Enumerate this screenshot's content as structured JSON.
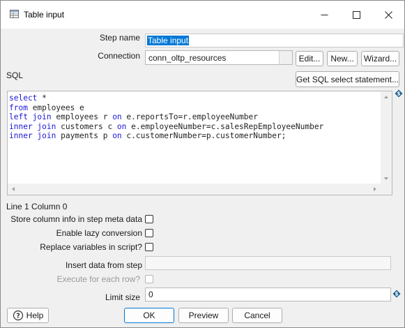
{
  "window": {
    "title": "Table input"
  },
  "form": {
    "step_name_label": "Step name",
    "step_name_value": "Table input",
    "connection_label": "Connection",
    "connection_value": "conn_oltp_resources",
    "edit_button": "Edit...",
    "new_button": "New...",
    "wizard_button": "Wizard...",
    "sql_label": "SQL",
    "get_sql_button": "Get SQL select statement...",
    "sql_lines": [
      [
        {
          "t": "select",
          "kw": true
        },
        {
          "t": " *",
          "kw": false
        }
      ],
      [
        {
          "t": "from",
          "kw": true
        },
        {
          "t": " employees e",
          "kw": false
        }
      ],
      [
        {
          "t": "left join",
          "kw": true
        },
        {
          "t": " employees r ",
          "kw": false
        },
        {
          "t": "on",
          "kw": true
        },
        {
          "t": " e.reportsTo=r.employeeNumber",
          "kw": false
        }
      ],
      [
        {
          "t": "inner join",
          "kw": true
        },
        {
          "t": " customers c ",
          "kw": false
        },
        {
          "t": "on",
          "kw": true
        },
        {
          "t": " e.employeeNumber=c.salesRepEmployeeNumber",
          "kw": false
        }
      ],
      [
        {
          "t": "inner join",
          "kw": true
        },
        {
          "t": " payments p ",
          "kw": false
        },
        {
          "t": "on",
          "kw": true
        },
        {
          "t": " c.customerNumber=p.customerNumber;",
          "kw": false
        }
      ]
    ],
    "cursor_position": "Line 1 Column 0",
    "store_column_info_label": "Store column info in step meta data",
    "enable_lazy_label": "Enable lazy conversion",
    "replace_variables_label": "Replace variables in script?",
    "insert_data_label": "Insert data from step",
    "insert_data_value": "",
    "execute_each_row_label": "Execute for each row?",
    "limit_size_label": "Limit size",
    "limit_size_value": "0"
  },
  "footer": {
    "help_button": "Help",
    "ok_button": "OK",
    "preview_button": "Preview",
    "cancel_button": "Cancel"
  },
  "colors": {
    "keyword": "#1c17d4",
    "selection": "#0078d7",
    "variable_icon": "#1d5f8f"
  },
  "icons": {
    "app": "table-input-icon",
    "minimize": "minimize-icon",
    "maximize": "maximize-icon",
    "close": "close-icon",
    "variable": "variable-diamond-icon",
    "help": "help-icon"
  }
}
